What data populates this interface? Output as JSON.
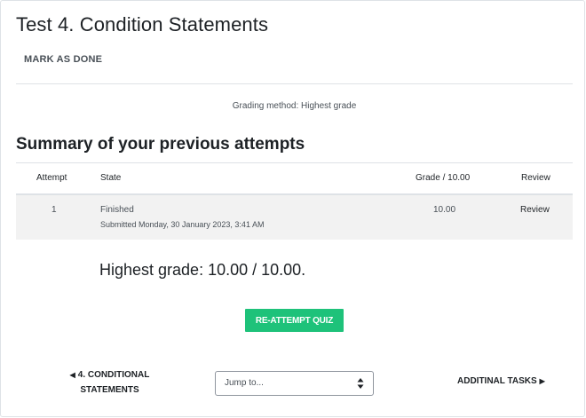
{
  "page": {
    "title": "Test 4. Condition Statements",
    "mark_done_label": "MARK AS DONE",
    "grading_method": "Grading method: Highest grade"
  },
  "summary": {
    "heading": "Summary of your previous attempts",
    "columns": {
      "attempt": "Attempt",
      "state": "State",
      "grade": "Grade / 10.00",
      "review": "Review"
    },
    "rows": [
      {
        "attempt": "1",
        "state": "Finished",
        "submitted": "Submitted Monday, 30 January 2023, 3:41 AM",
        "grade": "10.00",
        "review": "Review"
      }
    ]
  },
  "result": {
    "highest_grade": "Highest grade: 10.00 / 10.00."
  },
  "actions": {
    "reattempt_label": "RE-ATTEMPT QUIZ",
    "reattempt_color": "#1ec27a"
  },
  "navigation": {
    "prev_line1": "4. CONDITIONAL",
    "prev_line2": "STATEMENTS",
    "jump_placeholder": "Jump to...",
    "next_label": "ADDITINAL TASKS"
  },
  "icons": {
    "prev": "left-triangle-icon",
    "next": "right-triangle-icon",
    "select": "up-down-arrows-icon"
  }
}
